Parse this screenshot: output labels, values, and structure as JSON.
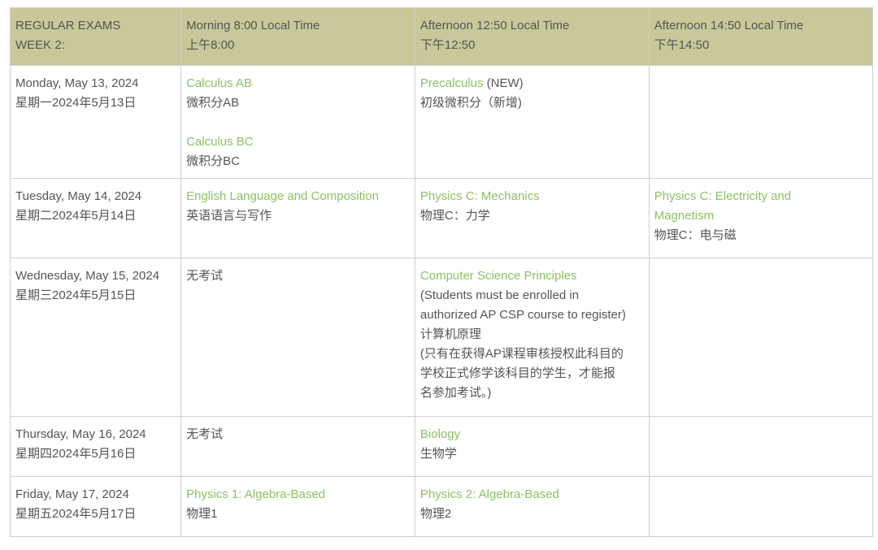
{
  "header": {
    "col1": [
      "REGULAR EXAMS",
      "WEEK 2:"
    ],
    "col2": [
      "Morning 8:00 Local Time",
      "上午8:00"
    ],
    "col3": [
      "Afternoon 12:50 Local Time",
      "下午12:50"
    ],
    "col4": [
      "Afternoon 14:50 Local Time",
      "下午14:50"
    ]
  },
  "rows": [
    {
      "day": [
        "Monday, May 13, 2024",
        "星期一2024年5月13日"
      ],
      "morning": [
        {
          "en": "Calculus AB",
          "zh": "微积分AB"
        },
        {
          "en": "Calculus BC",
          "zh": "微积分BC"
        }
      ],
      "afternoon1": {
        "en": "Precalculus",
        "suffix": " (NEW)",
        "zh": "初级微积分（新增)"
      },
      "afternoon2": null
    },
    {
      "day": [
        "Tuesday, May 14, 2024",
        "星期二2024年5月14日"
      ],
      "morning": {
        "en": "English Language and Composition",
        "zh": "英语语言与写作"
      },
      "afternoon1": {
        "en": "Physics C: Mechanics",
        "zh": "物理C：力学"
      },
      "afternoon2": {
        "en1": "Physics C: Electricity and",
        "en2": "Magnetism",
        "zh": "物理C：电与磁"
      }
    },
    {
      "day": [
        "Wednesday, May 15, 2024",
        "星期三2024年5月15日"
      ],
      "morning": {
        "text": "无考试"
      },
      "afternoon1": {
        "en": "Computer Science Principles",
        "note_lines": [
          "(Students must be enrolled in",
          "authorized AP CSP course to register)"
        ],
        "zh": "计算机原理",
        "zh_note_lines": [
          "(只有在获得AP课程审核授权此科目的",
          "学校正式修学该科目的学生，才能报",
          "名参加考试。)"
        ]
      },
      "afternoon2": null
    },
    {
      "day": [
        "Thursday, May 16, 2024",
        "星期四2024年5月16日"
      ],
      "morning": {
        "text": "无考试"
      },
      "afternoon1": {
        "en": "Biology",
        "zh": "生物学"
      },
      "afternoon2": null
    },
    {
      "day": [
        "Friday, May 17, 2024",
        "星期五2024年5月17日"
      ],
      "morning": {
        "en": "Physics 1: Algebra-Based",
        "zh": "物理1"
      },
      "afternoon1": {
        "en": "Physics 2: Algebra-Based",
        "zh": "物理2"
      },
      "afternoon2": null
    }
  ],
  "colors": {
    "header_bg": "#c8c89a",
    "exam_link": "#8cc063",
    "text": "#555555",
    "border": "#cfcfcf"
  }
}
